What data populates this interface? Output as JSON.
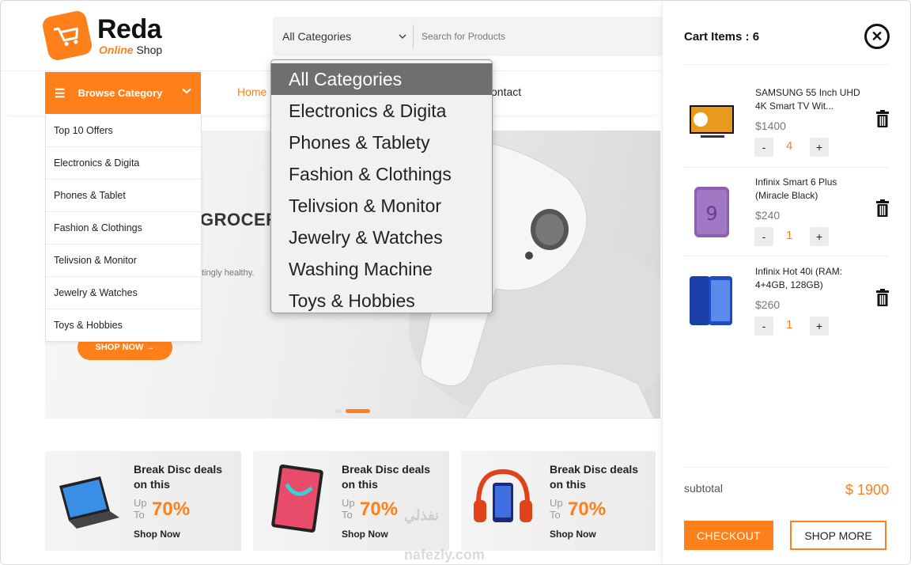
{
  "brand": {
    "name": "Reda",
    "sub_accent": "Online",
    "sub_rest": "Shop",
    "color": "#ff7f1a"
  },
  "search": {
    "category": "All Categories",
    "placeholder": "Search for Products"
  },
  "nav": {
    "browse": "Browse Category",
    "home": "Home",
    "contact": "ontact"
  },
  "categories": [
    "Top 10 Offers",
    "Electronics & Digita",
    "Phones & Tablet",
    "Fashion & Clothings",
    "Telivsion & Monitor",
    "Jewelry & Watches",
    "Toys & Hobbies"
  ],
  "dropdown": {
    "selected_index": 0,
    "options": [
      "All Categories",
      "Electronics & Digita",
      "Phones & Tablety",
      "Fashion & Clothings",
      "Telivsion & Monitor",
      "Jewelry & Watches",
      "Washing Machine",
      "Toys & Hobbies"
    ]
  },
  "hero": {
    "title": "GROCER",
    "text": "tingly healthy.",
    "button": "SHOP NOW →"
  },
  "promos": [
    {
      "title": "Break Disc deals on this",
      "up": "Up",
      "to": "To",
      "percent": "70%",
      "cta": "Shop Now",
      "icon": "laptop-icon"
    },
    {
      "title": "Break Disc deals on this",
      "up": "Up",
      "to": "To",
      "percent": "70%",
      "cta": "Shop Now",
      "icon": "tablet-icon"
    },
    {
      "title": "Break Disc deals on this",
      "up": "Up",
      "to": "To",
      "percent": "70%",
      "cta": "Shop Now",
      "icon": "headphone-phone-icon"
    }
  ],
  "watermark": {
    "arabic": "نفذلي",
    "latin": "nafezly.com"
  },
  "cart": {
    "title": "Cart Items : 6",
    "items": [
      {
        "name": "SAMSUNG 55 Inch UHD 4K Smart TV Wit...",
        "price": "$1400",
        "qty": "4",
        "minus": "-",
        "plus": "+",
        "icon": "tv-icon"
      },
      {
        "name": "Infinix Smart 6 Plus (Miracle Black)",
        "price": "$240",
        "qty": "1",
        "minus": "-",
        "plus": "+",
        "icon": "phone-icon"
      },
      {
        "name": "Infinix Hot 40i (RAM: 4+4GB, 128GB)",
        "price": "$260",
        "qty": "1",
        "minus": "-",
        "plus": "+",
        "icon": "phone-icon"
      }
    ],
    "subtotal_label": "subtotal",
    "subtotal_value": "$ 1900",
    "checkout": "CHECKOUT",
    "shop_more": "SHOP MORE"
  }
}
